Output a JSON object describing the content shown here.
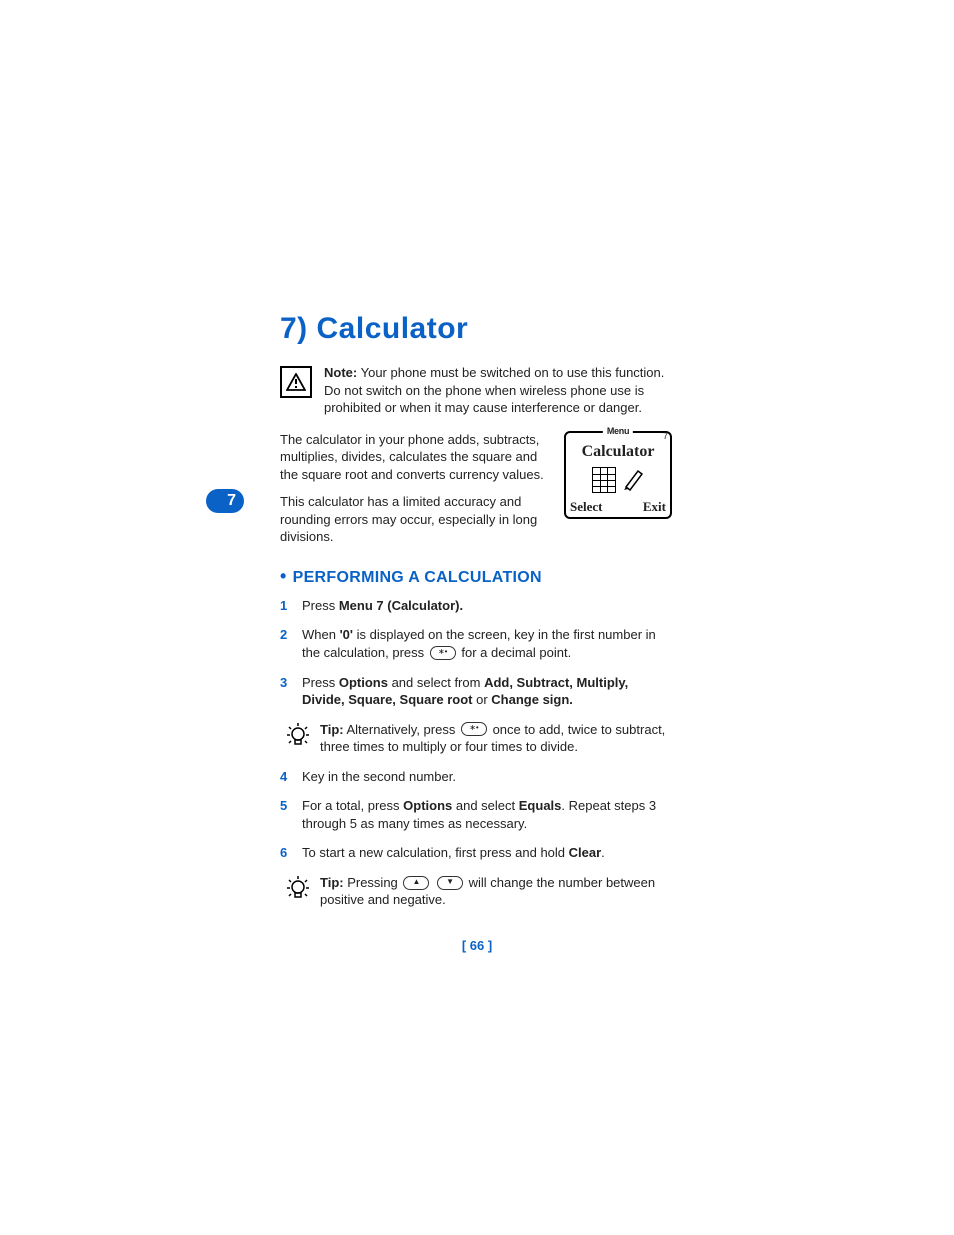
{
  "side_tab": "7",
  "title": "7) Calculator",
  "note": {
    "label": "Note:",
    "text": "Your phone must be switched on to use this function. Do not switch on the phone when wireless phone use is prohibited or when it may cause interference or danger."
  },
  "para1": "The calculator in your phone adds, subtracts, multiplies, divides, calculates the square and the square root and converts currency values.",
  "para2": "This calculator has a limited accuracy and rounding errors may occur, especially in long divisions.",
  "phone": {
    "menu": "Menu",
    "corner": "7",
    "title": "Calculator",
    "left": "Select",
    "right": "Exit"
  },
  "section_heading": "PERFORMING A CALCULATION",
  "steps": {
    "s1_a": "Press ",
    "s1_b": "Menu 7 (Calculator).",
    "s2_a": "When ",
    "s2_b": "'0'",
    "s2_c": " is displayed on the screen, key in the first number in the calculation, press ",
    "s2_d": " for a decimal point.",
    "s3_a": "Press ",
    "s3_b": "Options",
    "s3_c": " and select from ",
    "s3_d": "Add, Subtract, Multiply, Divide, Square, Square root",
    "s3_e": " or ",
    "s3_f": "Change sign.",
    "s4": "Key in the second number.",
    "s5_a": "For a total, press ",
    "s5_b": "Options",
    "s5_c": " and select ",
    "s5_d": "Equals",
    "s5_e": ". Repeat steps 3 through 5 as many times as necessary.",
    "s6_a": "To start a new calculation, first press and hold ",
    "s6_b": "Clear",
    "s6_c": "."
  },
  "tip1": {
    "label": "Tip:",
    "a": " Alternatively, press ",
    "b": " once to add, twice to subtract, three times to multiply or four times to divide."
  },
  "tip2": {
    "label": "Tip:",
    "a": " Pressing ",
    "b": " will change the number between positive and negative."
  },
  "page_number": "[ 66 ]"
}
